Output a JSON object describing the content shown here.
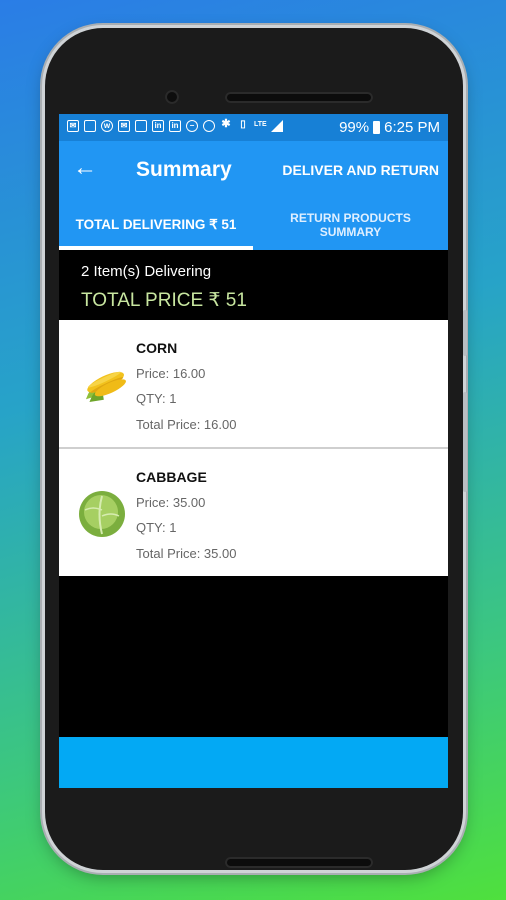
{
  "status": {
    "icons": [
      "mail-icon",
      "gallery-icon",
      "wifi-icon",
      "mail-icon",
      "image-icon",
      "linkedin-icon",
      "linkedin-icon",
      "minus-circle-icon",
      "location-icon",
      "bluetooth-icon",
      "vibrate-icon",
      "network-icon",
      "lte-icon",
      "signal-icon"
    ],
    "battery": "99%",
    "time": "6:25 PM"
  },
  "appbar": {
    "title": "Summary",
    "action": "DELIVER AND RETURN"
  },
  "tabs": [
    {
      "label": "TOTAL DELIVERING ₹ 51",
      "selected": true
    },
    {
      "label": "RETURN PRODUCTS SUMMARY",
      "selected": false
    }
  ],
  "summary": {
    "count_text": "2 Item(s) Delivering",
    "total_text": "TOTAL PRICE ₹ 51"
  },
  "products": [
    {
      "name": "CORN",
      "price": "Price: 16.00",
      "qty": "QTY: 1",
      "total": "Total Price: 16.00"
    },
    {
      "name": "CABBAGE",
      "price": "Price: 35.00",
      "qty": "QTY: 1",
      "total": "Total Price: 35.00"
    }
  ],
  "colors": {
    "primary": "#2196f3",
    "statusbar": "#1780d6",
    "bottombar": "#03a9f4",
    "total_text": "#c8e6a0"
  }
}
